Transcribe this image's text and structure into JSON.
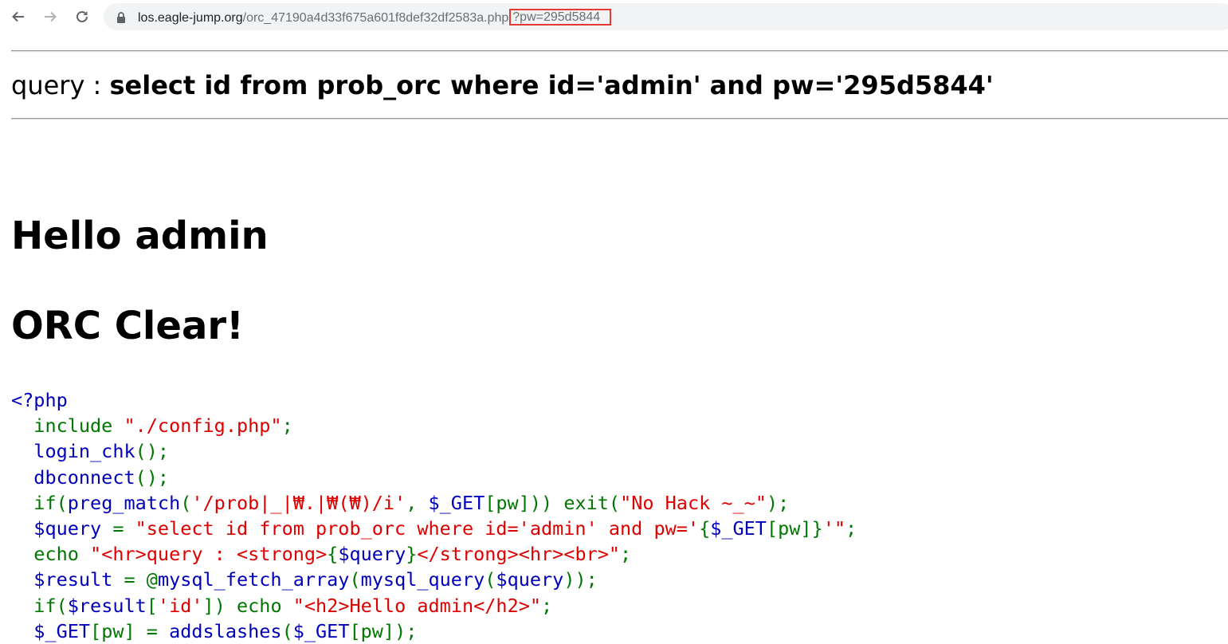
{
  "browser": {
    "url_host": "los.eagle-jump.org",
    "url_path": "/orc_47190a4d33f675a601f8def32df2583a.php",
    "url_query": "?pw=295d5844",
    "icons": [
      "back-arrow-icon",
      "forward-arrow-icon",
      "reload-icon",
      "lock-icon"
    ]
  },
  "page": {
    "query_label": "query : ",
    "query_text": "select id from prob_orc where id='admin' and pw='295d5844'",
    "hello": "Hello admin",
    "clear": "ORC Clear!"
  },
  "code": {
    "open_tag": "<?php",
    "l1_kw": "include ",
    "l1_str": "\"./config.php\"",
    "l1_end": ";",
    "l2_fn": "login_chk",
    "l2_end": "();",
    "l3_fn": "dbconnect",
    "l3_end": "();",
    "l4_kw": "if(",
    "l4_fn": "preg_match",
    "l4_p1": "(",
    "l4_str": "'/prob|_|₩.|₩(₩)/i'",
    "l4_c": ", ",
    "l4_var": "$_GET",
    "l4_idx": "[pw]",
    "l4_p2": ")) ",
    "l4_exit": "exit(",
    "l4_msg": "\"No Hack ~_~\"",
    "l4_end": ");",
    "l5_var": "$query ",
    "l5_eq": "= ",
    "l5_str1": "\"select id from prob_orc where id='admin' and pw='",
    "l5_br1": "{",
    "l5_var2": "$_GET",
    "l5_idx": "[pw]",
    "l5_br2": "}",
    "l5_str2": "'\"",
    "l5_end": ";",
    "l6_kw": "echo ",
    "l6_str1": "\"<hr>query : <strong>",
    "l6_br1": "{",
    "l6_var": "$query",
    "l6_br2": "}",
    "l6_str2": "</strong><hr><br>\"",
    "l6_end": ";",
    "l7_var": "$result ",
    "l7_eq": "= @",
    "l7_fn": "mysql_fetch_array",
    "l7_p1": "(",
    "l7_fn2": "mysql_query",
    "l7_p2": "(",
    "l7_var2": "$query",
    "l7_end": "));",
    "l8_kw": "if(",
    "l8_var": "$result",
    "l8_b1": "[",
    "l8_str": "'id'",
    "l8_b2": "]) ",
    "l8_echo": "echo ",
    "l8_str2": "\"<h2>Hello admin</h2>\"",
    "l8_end": ";",
    "l9_var": "$_GET",
    "l9_idx": "[pw] ",
    "l9_eq": "= ",
    "l9_fn": "addslashes",
    "l9_p": "(",
    "l9_var2": "$_GET",
    "l9_idx2": "[pw]",
    "l9_end": ");"
  },
  "colors": {
    "url_highlight_border": "#e53935",
    "code_blue": "#0000bb",
    "code_green": "#007700",
    "code_red": "#dd0000"
  }
}
